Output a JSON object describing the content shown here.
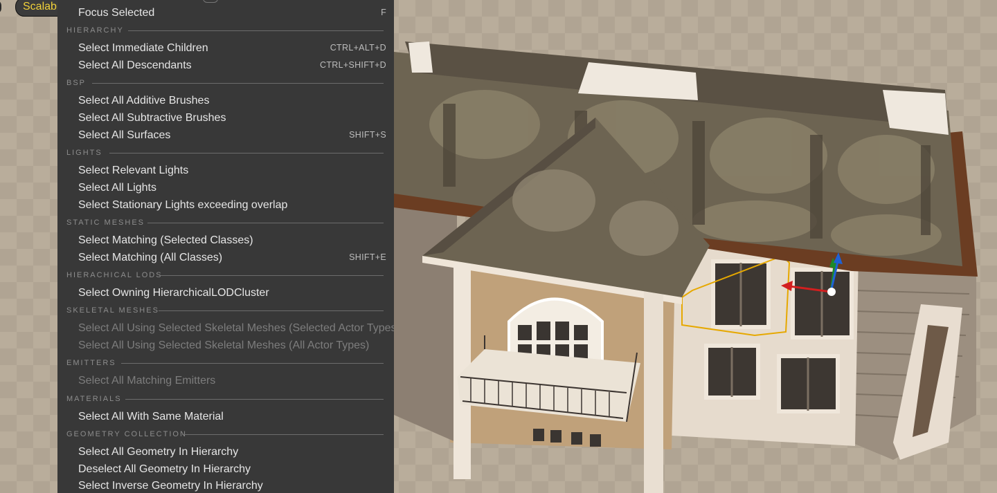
{
  "viewport": {
    "toolbar_chip_label": "Scalabi"
  },
  "menu": {
    "top_item": {
      "label": "Focus Selected",
      "shortcut": "F"
    },
    "sections": [
      {
        "header": "HIERARCHY",
        "items": [
          {
            "label": "Select Immediate Children",
            "shortcut": "CTRL+ALT+D",
            "enabled": true
          },
          {
            "label": "Select All Descendants",
            "shortcut": "CTRL+SHIFT+D",
            "enabled": true
          }
        ]
      },
      {
        "header": "BSP",
        "items": [
          {
            "label": "Select All Additive Brushes",
            "shortcut": "",
            "enabled": true
          },
          {
            "label": "Select All Subtractive Brushes",
            "shortcut": "",
            "enabled": true
          },
          {
            "label": "Select All Surfaces",
            "shortcut": "SHIFT+S",
            "enabled": true
          }
        ]
      },
      {
        "header": "LIGHTS",
        "items": [
          {
            "label": "Select Relevant Lights",
            "shortcut": "",
            "enabled": true
          },
          {
            "label": "Select All Lights",
            "shortcut": "",
            "enabled": true
          },
          {
            "label": "Select Stationary Lights exceeding overlap",
            "shortcut": "",
            "enabled": true
          }
        ]
      },
      {
        "header": "STATIC MESHES",
        "items": [
          {
            "label": "Select Matching (Selected Classes)",
            "shortcut": "",
            "enabled": true
          },
          {
            "label": "Select Matching (All Classes)",
            "shortcut": "SHIFT+E",
            "enabled": true
          }
        ]
      },
      {
        "header": "HIERACHICAL LODS",
        "items": [
          {
            "label": "Select Owning HierarchicalLODCluster",
            "shortcut": "",
            "enabled": true
          }
        ]
      },
      {
        "header": "SKELETAL MESHES",
        "items": [
          {
            "label": "Select All Using Selected Skeletal Meshes (Selected Actor Types)",
            "shortcut": "",
            "enabled": false
          },
          {
            "label": "Select All Using Selected Skeletal Meshes (All Actor Types)",
            "shortcut": "",
            "enabled": false
          }
        ]
      },
      {
        "header": "EMITTERS",
        "items": [
          {
            "label": "Select All Matching Emitters",
            "shortcut": "",
            "enabled": false
          }
        ]
      },
      {
        "header": "MATERIALS",
        "items": [
          {
            "label": "Select All With Same Material",
            "shortcut": "",
            "enabled": true
          }
        ]
      },
      {
        "header": "GEOMETRY COLLECTION",
        "items": [
          {
            "label": "Select All Geometry In Hierarchy",
            "shortcut": "",
            "enabled": true
          },
          {
            "label": "Deselect All Geometry In Hierarchy",
            "shortcut": "",
            "enabled": true
          },
          {
            "label": "Select Inverse Geometry In Hierarchy",
            "shortcut": "",
            "enabled": true
          }
        ]
      }
    ]
  },
  "colors": {
    "menu_bg": "#383838",
    "menu_text": "#e6e6e6",
    "disabled_text": "#7d7d7d",
    "header_text": "#8d8d8d",
    "chip_text": "#f2d23a",
    "selection_outline": "#e6a800",
    "gizmo_x": "#d21f1f",
    "gizmo_y": "#1d8a2a",
    "gizmo_z": "#1e62d6"
  }
}
